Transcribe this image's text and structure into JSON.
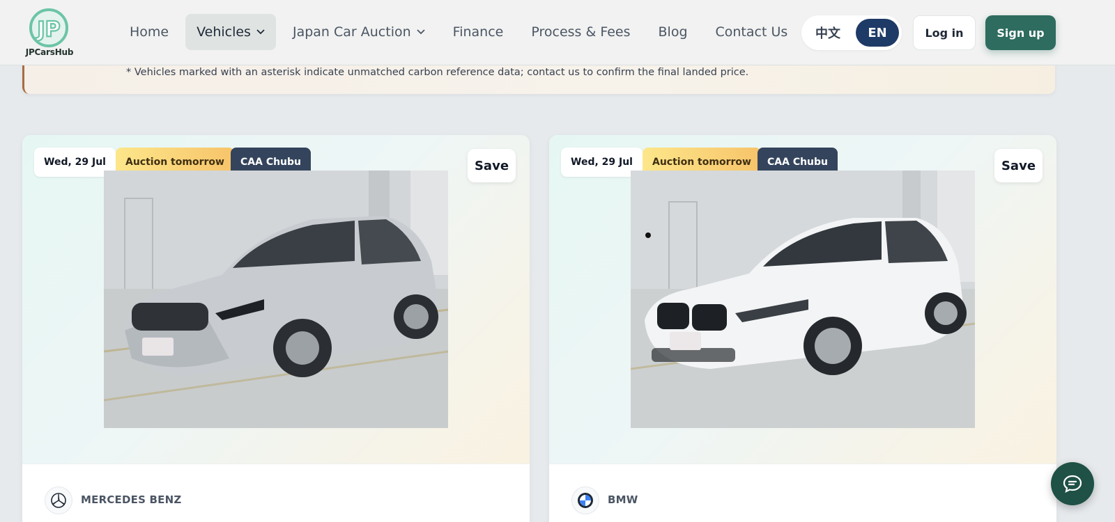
{
  "brand": {
    "logo_text": "JPCarsHub",
    "accent": "#2d6c5f"
  },
  "nav": {
    "items": [
      {
        "label": "Home"
      },
      {
        "label": "Vehicles",
        "active": true,
        "dropdown": true
      },
      {
        "label": "Japan Car Auction",
        "dropdown": true
      },
      {
        "label": "Finance"
      },
      {
        "label": "Process & Fees"
      },
      {
        "label": "Blog"
      },
      {
        "label": "Contact Us"
      }
    ]
  },
  "lang": {
    "zh": "中文",
    "en": "EN",
    "selected": "EN"
  },
  "auth": {
    "login": "Log in",
    "signup": "Sign up"
  },
  "notice": {
    "text": "* Vehicles marked with an asterisk indicate unmatched carbon reference data; contact us to confirm the final landed price."
  },
  "cards": [
    {
      "date": "Wed, 29 Jul",
      "auction_status": "Auction tomorrow",
      "venue": "CAA Chubu",
      "save_label": "Save",
      "brand": "MERCEDES BENZ",
      "car_color": "#c8ccd1"
    },
    {
      "date": "Wed, 29 Jul",
      "auction_status": "Auction tomorrow",
      "venue": "CAA Chubu",
      "save_label": "Save",
      "brand": "BMW",
      "car_color": "#f4f5f6"
    }
  ]
}
